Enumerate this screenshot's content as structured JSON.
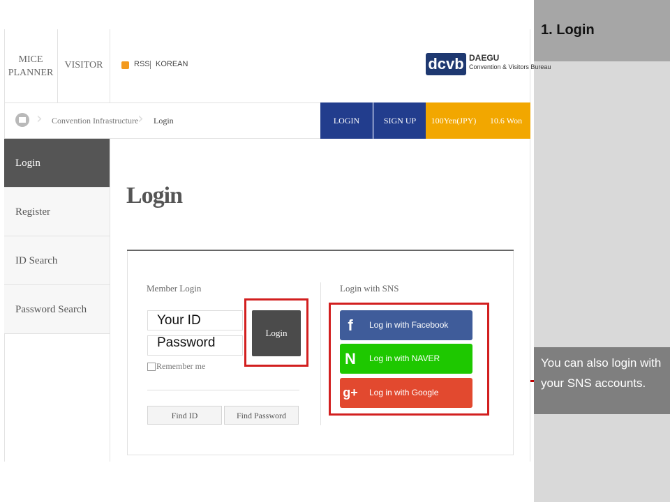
{
  "annotation": {
    "step_title": "1. Login",
    "note": "You can also login with your SNS accounts."
  },
  "topnav": {
    "mice_line1": "MICE",
    "mice_line2": "PLANNER",
    "visitor": "VISITOR",
    "rss": "RSS",
    "korean": "KOREAN",
    "logo_mark": "dcvb",
    "logo_line1": "DAEGU",
    "logo_line2": "Convention & Visitors Bureau"
  },
  "breadcrumb": {
    "items": [
      "Convention Infrastructure",
      "Login"
    ]
  },
  "header_buttons": {
    "login": "LOGIN",
    "signup": "SIGN UP",
    "yen": "100Yen(JPY)",
    "won": "10.6 Won"
  },
  "sidebar": {
    "items": [
      {
        "label": "Login"
      },
      {
        "label": "Register"
      },
      {
        "label": "ID Search"
      },
      {
        "label": "Password Search"
      }
    ]
  },
  "main": {
    "title": "Login",
    "member_title": "Member Login",
    "id_label": "Your ID",
    "pw_label": "Password",
    "login_button": "Login",
    "remember": "Remember me",
    "find_id": "Find ID",
    "find_password": "Find Password",
    "sns_title": "Login with SNS",
    "sns": [
      {
        "icon": "f",
        "label": "Log in with Facebook"
      },
      {
        "icon": "N",
        "label": "Log in with NAVER"
      },
      {
        "icon": "g+",
        "label": "Log in with Google"
      }
    ]
  },
  "colors": {
    "highlight": "#d21f1f",
    "nav_blue": "#223d8d",
    "nav_orange": "#f2a700",
    "facebook": "#3f5c9a",
    "naver": "#1ec800",
    "google": "#e2492f"
  }
}
